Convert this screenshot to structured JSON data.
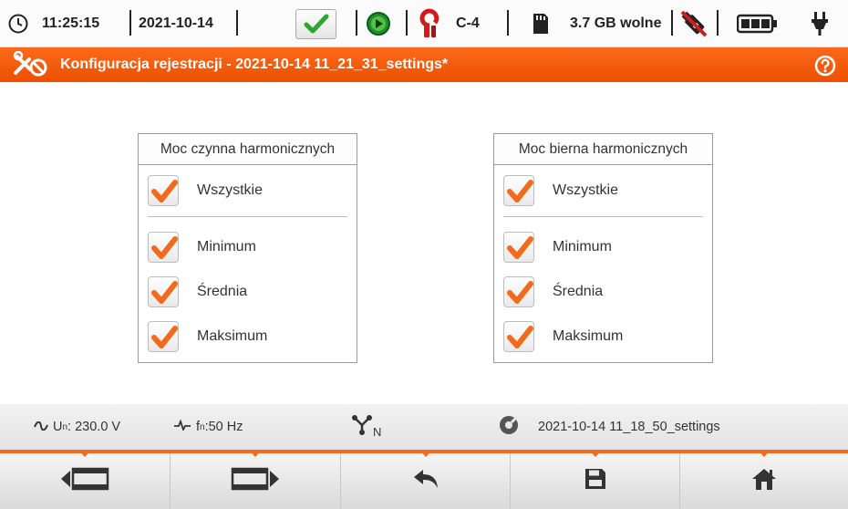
{
  "statusbar": {
    "time": "11:25:15",
    "date": "2021-10-14",
    "clamp_label": "C-4",
    "storage_text": "3.7 GB wolne",
    "icons": [
      "clock-icon",
      "ok-check-icon",
      "recording-play-icon",
      "current-clamp-icon",
      "sd-card-icon",
      "usb-disconnected-icon",
      "battery-icon",
      "power-plug-icon"
    ]
  },
  "titlebar": {
    "title": "Konfiguracja rejestracji - 2021-10-14 11_21_31_settings*",
    "icons": [
      "settings-tools-icon",
      "help-icon"
    ]
  },
  "panels": [
    {
      "title": "Moc czynna harmonicznych",
      "all_label": "Wszystkie",
      "options": [
        "Minimum",
        "Średnia",
        "Maksimum"
      ],
      "checked": [
        true,
        true,
        true,
        true
      ]
    },
    {
      "title": "Moc bierna harmonicznych",
      "all_label": "Wszystkie",
      "options": [
        "Minimum",
        "Średnia",
        "Maksimum"
      ],
      "checked": [
        true,
        true,
        true,
        true
      ]
    }
  ],
  "infobar": {
    "voltage_label": "U",
    "voltage_sub": "n",
    "voltage_value": ": 230.0 V",
    "freq_label": "f",
    "freq_sub": "n",
    "freq_value": ":50 Hz",
    "network_sub": "N",
    "settings_file": "2021-10-14 11_18_50_settings"
  },
  "navbar": {
    "buttons": [
      "prev-screen",
      "next-screen",
      "back",
      "save",
      "home"
    ]
  },
  "colors": {
    "accent": "#f26a1b",
    "title_bar": "#f45d0c",
    "check": "#f26a1b",
    "ok_green": "#3aa63a"
  }
}
